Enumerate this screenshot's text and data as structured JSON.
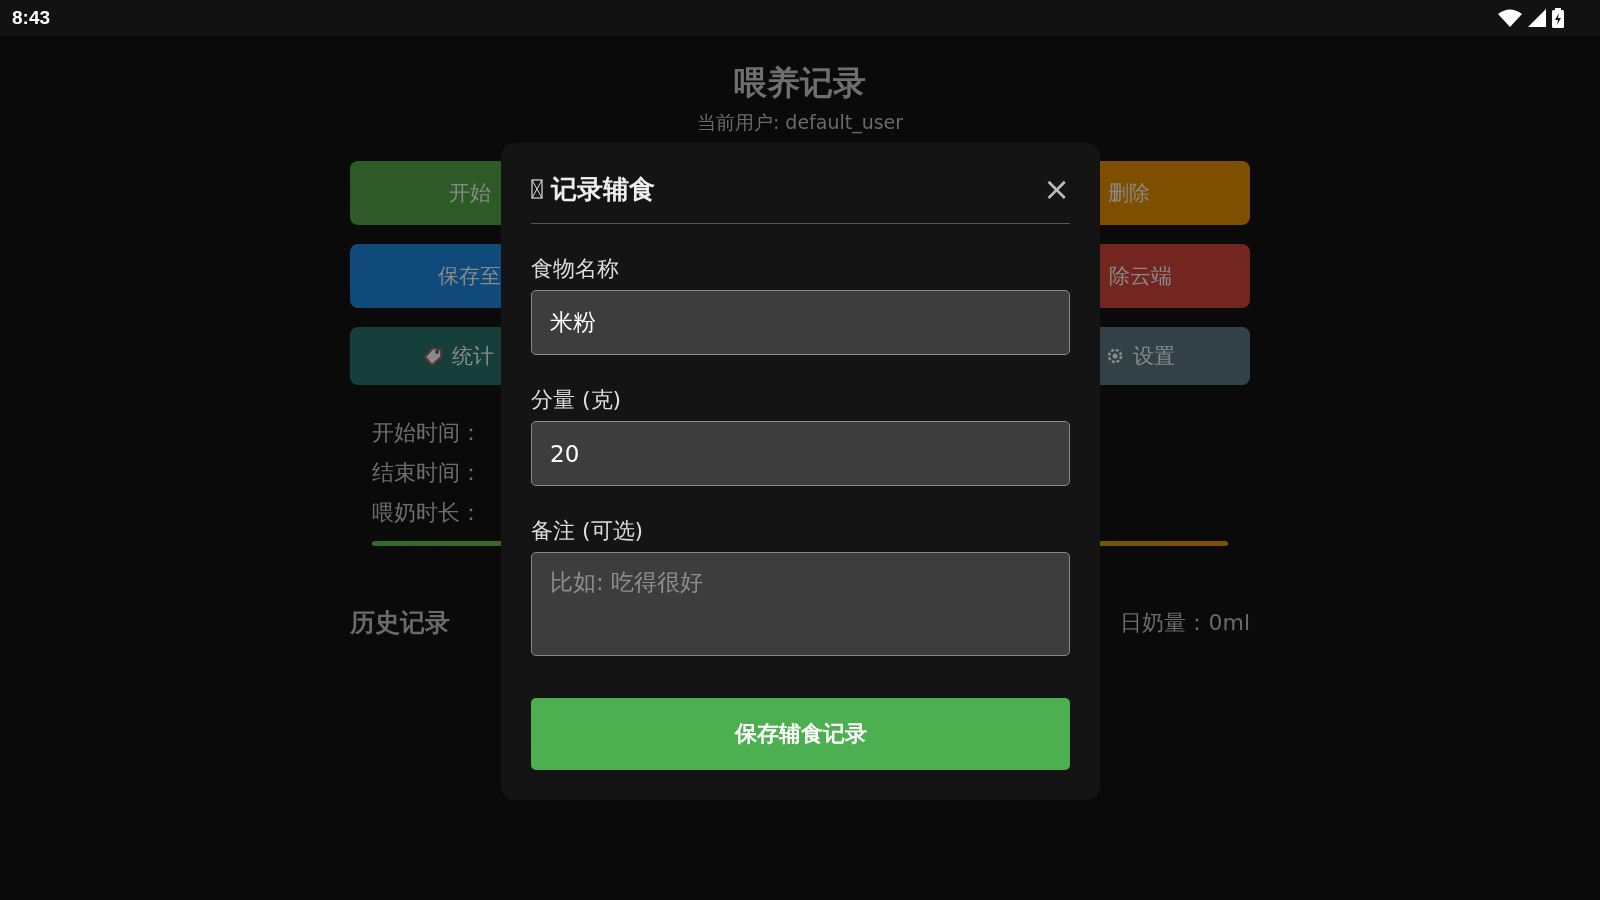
{
  "status_bar": {
    "time": "8:43"
  },
  "page": {
    "title": "喂养记录",
    "subtitle": "当前用户: default_user",
    "buttons": [
      {
        "label": "开始",
        "color": "#2d5a27",
        "kind": "plain"
      },
      {
        "label": "删除",
        "color": "#7f4f00",
        "kind": "plain"
      },
      {
        "label": "保存至",
        "color": "#0f4a7a",
        "kind": "plain"
      },
      {
        "label": "除云端",
        "color": "#73261f",
        "kind": "plain"
      },
      {
        "label": "统计",
        "color": "#163f3c",
        "kind": "stats"
      },
      {
        "label": "设置",
        "color": "#324048",
        "kind": "settings"
      }
    ],
    "info": [
      "开始时间：",
      "结束时间：",
      "喂奶时长："
    ],
    "history_title": "历史记录",
    "today_total": "日奶量：0ml"
  },
  "dialog": {
    "title": "记录辅食",
    "close": "×",
    "fields": [
      {
        "kind": "text",
        "label": "食物名称",
        "value": "米粉"
      },
      {
        "kind": "text",
        "label": "分量 (克)",
        "value": "20"
      },
      {
        "kind": "textarea",
        "label": "备注 (可选)",
        "placeholder": "比如: 吃得很好"
      }
    ],
    "submit": "保存辅食记录"
  }
}
